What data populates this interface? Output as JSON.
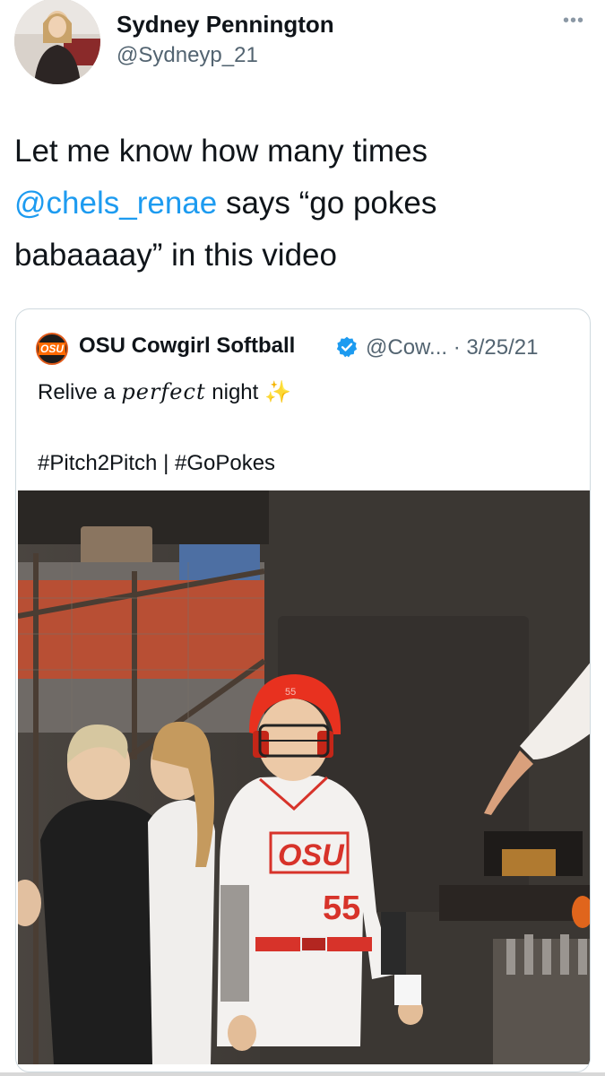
{
  "author": {
    "name": "Sydney Pennington",
    "handle": "@Sydneyp_21",
    "more_icon": "ellipsis-icon"
  },
  "tweet": {
    "text_before": "Let me know how many times ",
    "mention": "@chels_renae",
    "text_after": " says “go pokes babaaaay” in this video"
  },
  "quoted": {
    "logo_text": "OSU",
    "name": "OSU Cowgirl Softball",
    "handle_date": "@Cow... · 3/25/21",
    "line1_before": "Relive a ",
    "line1_script": "perfect",
    "line1_after": " night ",
    "sparkle": "✨",
    "line2": "#Pitch2Pitch | #GoPokes",
    "media": {
      "helmet_number": "55",
      "jersey_logo": "OSU",
      "jersey_number": "55"
    }
  },
  "colors": {
    "link": "#1d9bf0",
    "verified": "#1d9bf0",
    "osu_orange": "#ff6a00"
  }
}
